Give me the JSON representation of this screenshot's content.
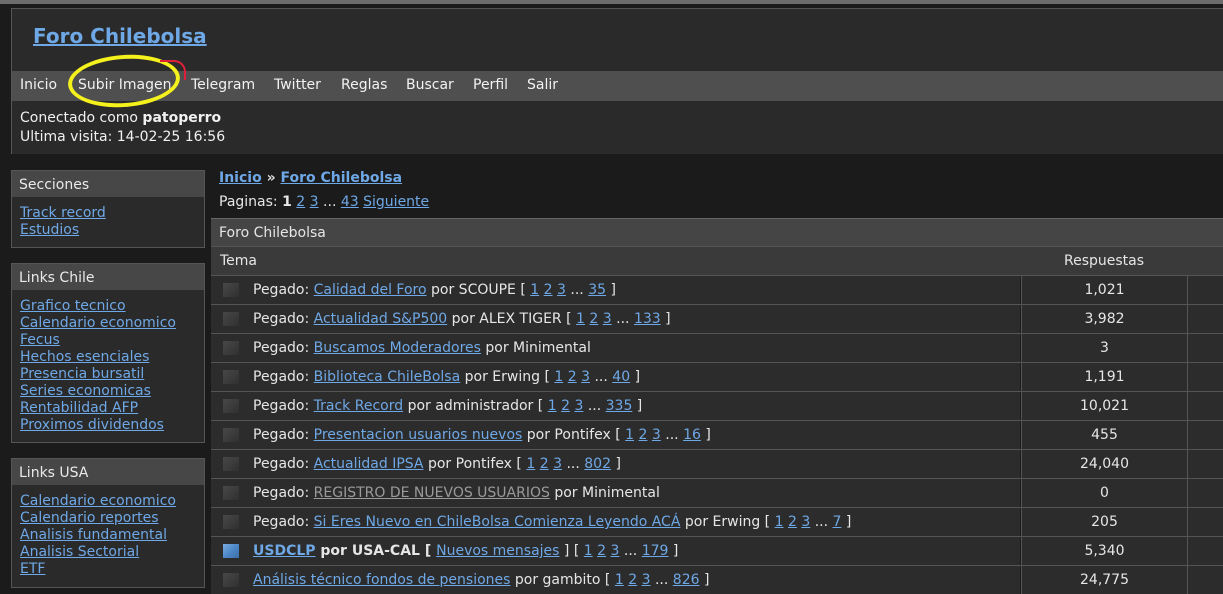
{
  "site_title": "Foro Chilebolsa",
  "nav": [
    {
      "label": "Inicio"
    },
    {
      "label": "Subir Imagen"
    },
    {
      "label": "Telegram"
    },
    {
      "label": "Twitter"
    },
    {
      "label": "Reglas"
    },
    {
      "label": "Buscar"
    },
    {
      "label": "Perfil"
    },
    {
      "label": "Salir"
    }
  ],
  "login": {
    "prefix": "Conectado como ",
    "user": "patoperro",
    "last_visit": "Ultima visita: 14-02-25 16:56"
  },
  "sidebar": {
    "secciones": {
      "title": "Secciones",
      "links": [
        "Track record",
        "Estudios"
      ]
    },
    "links_chile": {
      "title": "Links Chile",
      "links": [
        "Grafico tecnico",
        "Calendario economico",
        "Fecus",
        "Hechos esenciales",
        "Presencia bursatil",
        "Series economicas",
        "Rentabilidad AFP",
        "Proximos dividendos"
      ]
    },
    "links_usa": {
      "title": "Links USA",
      "links": [
        "Calendario economico",
        "Calendario reportes",
        "Analisis fundamental",
        "Analisis Sectorial",
        "ETF"
      ]
    }
  },
  "breadcrumb": {
    "home": "Inicio",
    "sep": " » ",
    "forum": "Foro Chilebolsa"
  },
  "pagination": {
    "label": "Paginas: ",
    "current": "1",
    "p2": "2",
    "p3": "3",
    "ellipsis": " ... ",
    "last": "43",
    "next": "Siguiente"
  },
  "forum": {
    "name": "Foro Chilebolsa",
    "col_topic": "Tema",
    "col_replies": "Respuestas"
  },
  "topics": [
    {
      "prefix": "Pegado: ",
      "title": "Calidad del Foro",
      "by": " por SCOUPE [ ",
      "p": [
        "1",
        "2",
        "3"
      ],
      "last": "35",
      "replies": "1,021"
    },
    {
      "prefix": "Pegado: ",
      "title": "Actualidad S&P500",
      "by": " por ALEX TIGER [ ",
      "p": [
        "1",
        "2",
        "3"
      ],
      "last": "133",
      "replies": "3,982"
    },
    {
      "prefix": "Pegado: ",
      "title": "Buscamos Moderadores",
      "by": " por Minimental",
      "replies": "3"
    },
    {
      "prefix": "Pegado: ",
      "title": "Biblioteca ChileBolsa",
      "by": " por Erwing [ ",
      "p": [
        "1",
        "2",
        "3"
      ],
      "last": "40",
      "replies": "1,191"
    },
    {
      "prefix": "Pegado: ",
      "title": "Track Record",
      "by": " por administrador [ ",
      "p": [
        "1",
        "2",
        "3"
      ],
      "last": "335",
      "replies": "10,021"
    },
    {
      "prefix": "Pegado: ",
      "title": "Presentacion usuarios nuevos",
      "by": " por Pontifex [ ",
      "p": [
        "1",
        "2",
        "3"
      ],
      "last": "16",
      "replies": "455"
    },
    {
      "prefix": "Pegado: ",
      "title": "Actualidad IPSA",
      "by": " por Pontifex [ ",
      "p": [
        "1",
        "2",
        "3"
      ],
      "last": "802",
      "replies": "24,040"
    },
    {
      "prefix": "Pegado: ",
      "title": "REGISTRO DE NUEVOS USUARIOS",
      "by": " por Minimental",
      "replies": "0"
    },
    {
      "prefix": "Pegado: ",
      "title": "Si Eres Nuevo en ChileBolsa Comienza Leyendo ACÁ",
      "by": " por Erwing [ ",
      "p": [
        "1",
        "2",
        "3"
      ],
      "last": "7",
      "replies": "205"
    },
    {
      "title": "USDCLP",
      "by": " por USA-CAL [ ",
      "extra": "Nuevos mensajes",
      "p": [
        "1",
        "2",
        "3"
      ],
      "last": "179",
      "replies": "5,340"
    },
    {
      "title": "Análisis técnico fondos de pensiones",
      "by": " por gambito [ ",
      "p": [
        "1",
        "2",
        "3"
      ],
      "last": "826",
      "replies": "24,775"
    }
  ],
  "colors": {
    "link": "#6fa8e6",
    "background": "#1b1b1b",
    "highlight": "#f4f11c"
  }
}
